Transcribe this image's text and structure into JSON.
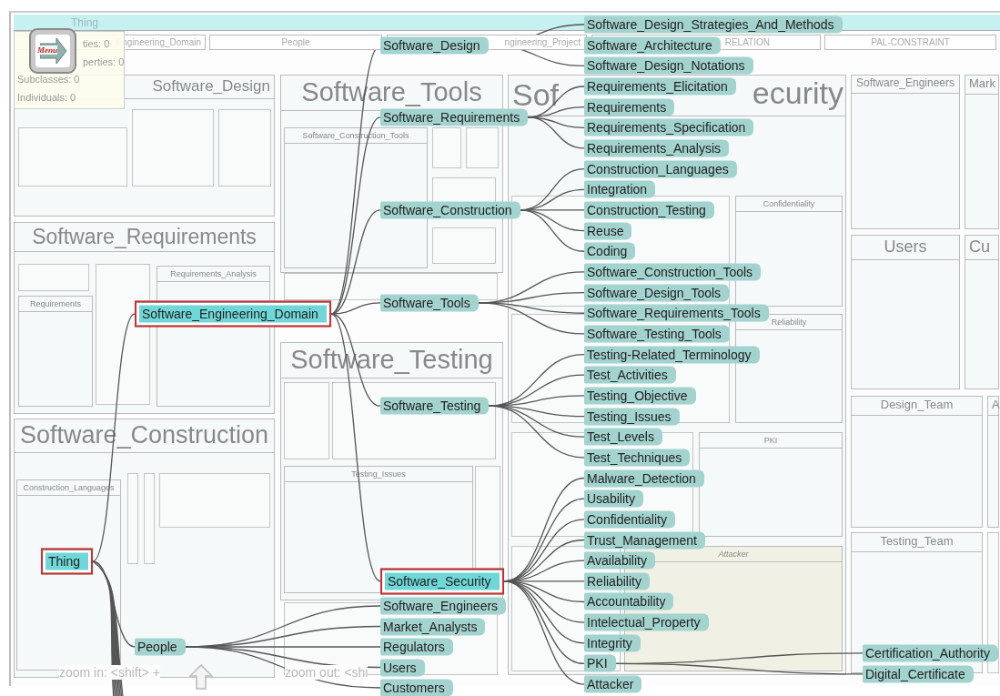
{
  "top_bar": {
    "title": "Thing"
  },
  "menu_button": {
    "label": "Menu"
  },
  "info_panel": {
    "lines": [
      "ties: 0",
      "perties: 0",
      "Subclasses: 0",
      "Individuals: 0"
    ]
  },
  "header_row": [
    "Engineering_Domain",
    "People",
    "ngineering_Project",
    "RELATION",
    "PAL-CONSTRAINT"
  ],
  "treemap": {
    "panels": [
      {
        "title": "Software_Design"
      },
      {
        "title": "Software_Tools"
      },
      {
        "title": "Software_Requirements"
      },
      {
        "title": "Software_Testing"
      },
      {
        "title": "Software_Construction"
      },
      {
        "title": "Sof",
        "title_end": "ecurity"
      },
      {
        "title": "Software_Engineers"
      },
      {
        "title": "Mark"
      },
      {
        "title": "Users"
      },
      {
        "title": "Cu"
      },
      {
        "title": "Design_Team"
      },
      {
        "title": "A"
      },
      {
        "title": "Testing_Team"
      }
    ],
    "sub_panels": [
      {
        "title": "Requirements"
      },
      {
        "title": "Requirements_Analysis"
      },
      {
        "title": "Construction_Languages"
      },
      {
        "title": "Software_Construction_Tools"
      },
      {
        "title": "Testing_Issues"
      },
      {
        "title": "Confidentiality"
      },
      {
        "title": "Reliability"
      },
      {
        "title": "PKI"
      },
      {
        "title": "Attacker"
      }
    ]
  },
  "tree": {
    "name": "Thing",
    "selected": true,
    "children": [
      {
        "name": "Software_Engineering_Domain",
        "selected": true,
        "children": [
          {
            "name": "Software_Design",
            "selected": false,
            "children": [
              {
                "name": "Software_Design_Strategies_And_Methods",
                "selected": false
              },
              {
                "name": "Software_Architecture",
                "selected": false
              },
              {
                "name": "Software_Design_Notations",
                "selected": false
              }
            ]
          },
          {
            "name": "Software_Requirements",
            "selected": false,
            "children": [
              {
                "name": "Requirements_Elicitation",
                "selected": false
              },
              {
                "name": "Requirements",
                "selected": false
              },
              {
                "name": "Requirements_Specification",
                "selected": false
              },
              {
                "name": "Requirements_Analysis",
                "selected": false
              }
            ]
          },
          {
            "name": "Software_Construction",
            "selected": false,
            "children": [
              {
                "name": "Construction_Languages",
                "selected": false
              },
              {
                "name": "Integration",
                "selected": false
              },
              {
                "name": "Construction_Testing",
                "selected": false
              },
              {
                "name": "Reuse",
                "selected": false
              },
              {
                "name": "Coding",
                "selected": false
              }
            ]
          },
          {
            "name": "Software_Tools",
            "selected": false,
            "children": [
              {
                "name": "Software_Construction_Tools",
                "selected": false
              },
              {
                "name": "Software_Design_Tools",
                "selected": false
              },
              {
                "name": "Software_Requirements_Tools",
                "selected": false
              },
              {
                "name": "Software_Testing_Tools",
                "selected": false
              }
            ]
          },
          {
            "name": "Software_Testing",
            "selected": false,
            "children": [
              {
                "name": "Testing-Related_Terminology",
                "selected": false
              },
              {
                "name": "Test_Activities",
                "selected": false
              },
              {
                "name": "Testing_Objective",
                "selected": false
              },
              {
                "name": "Testing_Issues",
                "selected": false
              },
              {
                "name": "Test_Levels",
                "selected": false
              },
              {
                "name": "Test_Techniques",
                "selected": false
              }
            ]
          },
          {
            "name": "Software_Security",
            "selected": true,
            "children": [
              {
                "name": "Malware_Detection",
                "selected": false
              },
              {
                "name": "Usability",
                "selected": false
              },
              {
                "name": "Confidentiality",
                "selected": false
              },
              {
                "name": "Trust_Management",
                "selected": false
              },
              {
                "name": "Availability",
                "selected": false
              },
              {
                "name": "Reliability",
                "selected": false
              },
              {
                "name": "Accountability",
                "selected": false
              },
              {
                "name": "Intelectual_Property",
                "selected": false
              },
              {
                "name": "Integrity",
                "selected": false
              },
              {
                "name": "PKI",
                "selected": false,
                "children": [
                  {
                    "name": "Certification_Authority",
                    "selected": false
                  },
                  {
                    "name": "Digital_Certificate",
                    "selected": false
                  }
                ]
              },
              {
                "name": "Attacker",
                "selected": false
              }
            ]
          }
        ]
      },
      {
        "name": "People",
        "selected": false,
        "children": [
          {
            "name": "Software_Engineers",
            "selected": false
          },
          {
            "name": "Market_Analysts",
            "selected": false
          },
          {
            "name": "Regulators",
            "selected": false
          },
          {
            "name": "Users",
            "selected": false
          },
          {
            "name": "Customers",
            "selected": false
          }
        ]
      }
    ]
  },
  "footer": {
    "zoom_in": "zoom in: <shift> +",
    "zoom_out": "zoom out: <shi"
  }
}
